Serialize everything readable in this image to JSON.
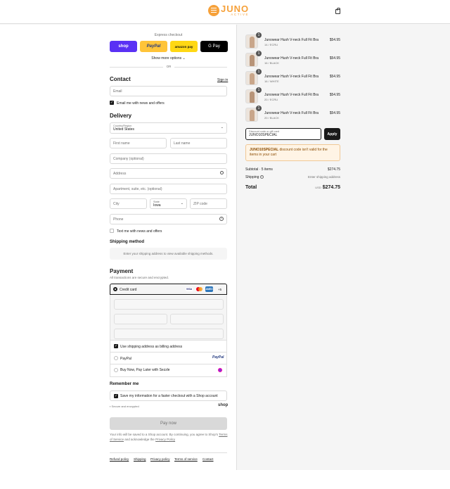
{
  "header": {
    "logo_main": "JUNO",
    "logo_sub": "ACTIVE",
    "cart_icon": "shopping-bag-icon"
  },
  "express": {
    "title": "Express checkout",
    "buttons": [
      {
        "label": "shop",
        "color": "#5a31f4"
      },
      {
        "label": "PayPal",
        "color": "#ffc439"
      },
      {
        "label": "amazon pay",
        "color": "#ffd814"
      },
      {
        "label": "G Pay",
        "color": "#000000"
      }
    ],
    "show_more": "Show more options",
    "or": "OR"
  },
  "contact": {
    "title": "Contact",
    "sign_in": "Sign in",
    "email_placeholder": "Email",
    "news_label": "Email me with news and offers"
  },
  "delivery": {
    "title": "Delivery",
    "country_label": "Country/Region",
    "country_value": "United States",
    "first_name": "First name",
    "last_name": "Last name",
    "company": "Company (optional)",
    "address": "Address",
    "apartment": "Apartment, suite, etc. (optional)",
    "city": "City",
    "state_label": "State",
    "state_value": "Iowa",
    "zip": "ZIP code",
    "phone": "Phone",
    "text_news": "Text me with news and offers"
  },
  "shipping": {
    "title": "Shipping method",
    "info": "Enter your shipping address to view available shipping methods."
  },
  "payment": {
    "title": "Payment",
    "subtitle": "All transactions are secure and encrypted.",
    "credit_card": "Credit card",
    "more_cards": "+5",
    "billing_same": "Use shipping address as billing address",
    "paypal": "PayPal",
    "sezzle": "Buy Now, Pay Later with Sezzle"
  },
  "remember": {
    "title": "Remember me",
    "save_label": "Save my information for a faster checkout with a Shop account",
    "secure": "Secure and encrypted",
    "shop": "shop"
  },
  "pay_now": "Pay now",
  "legal": {
    "text1": "Your info will be saved to a Shop account. By continuing, you agree to Shop's",
    "terms": "Terms of Service",
    "and_ack": "and acknowledge the",
    "privacy": "Privacy Policy"
  },
  "footer": {
    "links": [
      "Refund policy",
      "Shipping",
      "Privacy policy",
      "Terms of service",
      "Contact"
    ]
  },
  "cart": {
    "items": [
      {
        "qty": "1",
        "name": "Junowear Hush V-neck Full Fit Bra",
        "variant": "14 / ECRU",
        "price": "$54.95"
      },
      {
        "qty": "1",
        "name": "Junowear Hush V-neck Full Fit Bra",
        "variant": "16 / BLACK",
        "price": "$54.95"
      },
      {
        "qty": "1",
        "name": "Junowear Hush V-neck Full Fit Bra",
        "variant": "16 / WHITE",
        "price": "$54.95"
      },
      {
        "qty": "1",
        "name": "Junowear Hush V-neck Full Fit Bra",
        "variant": "20 / ECRU",
        "price": "$54.95"
      },
      {
        "qty": "1",
        "name": "Junowear Hush V-neck Full Fit Bra",
        "variant": "20 / BLACK",
        "price": "$54.95"
      }
    ],
    "discount_label": "Discount code or gift card",
    "discount_value": "JUNO10SPECIAL",
    "apply": "Apply",
    "error_code": "JUNO10SPECIAL",
    "error_text": "discount code isn't valid for the items in your cart",
    "subtotal_label": "Subtotal · 5 items",
    "subtotal": "$274.75",
    "shipping_label": "Shipping",
    "shipping_value": "Enter shipping address",
    "total_label": "Total",
    "currency": "USD",
    "total": "$274.75"
  }
}
